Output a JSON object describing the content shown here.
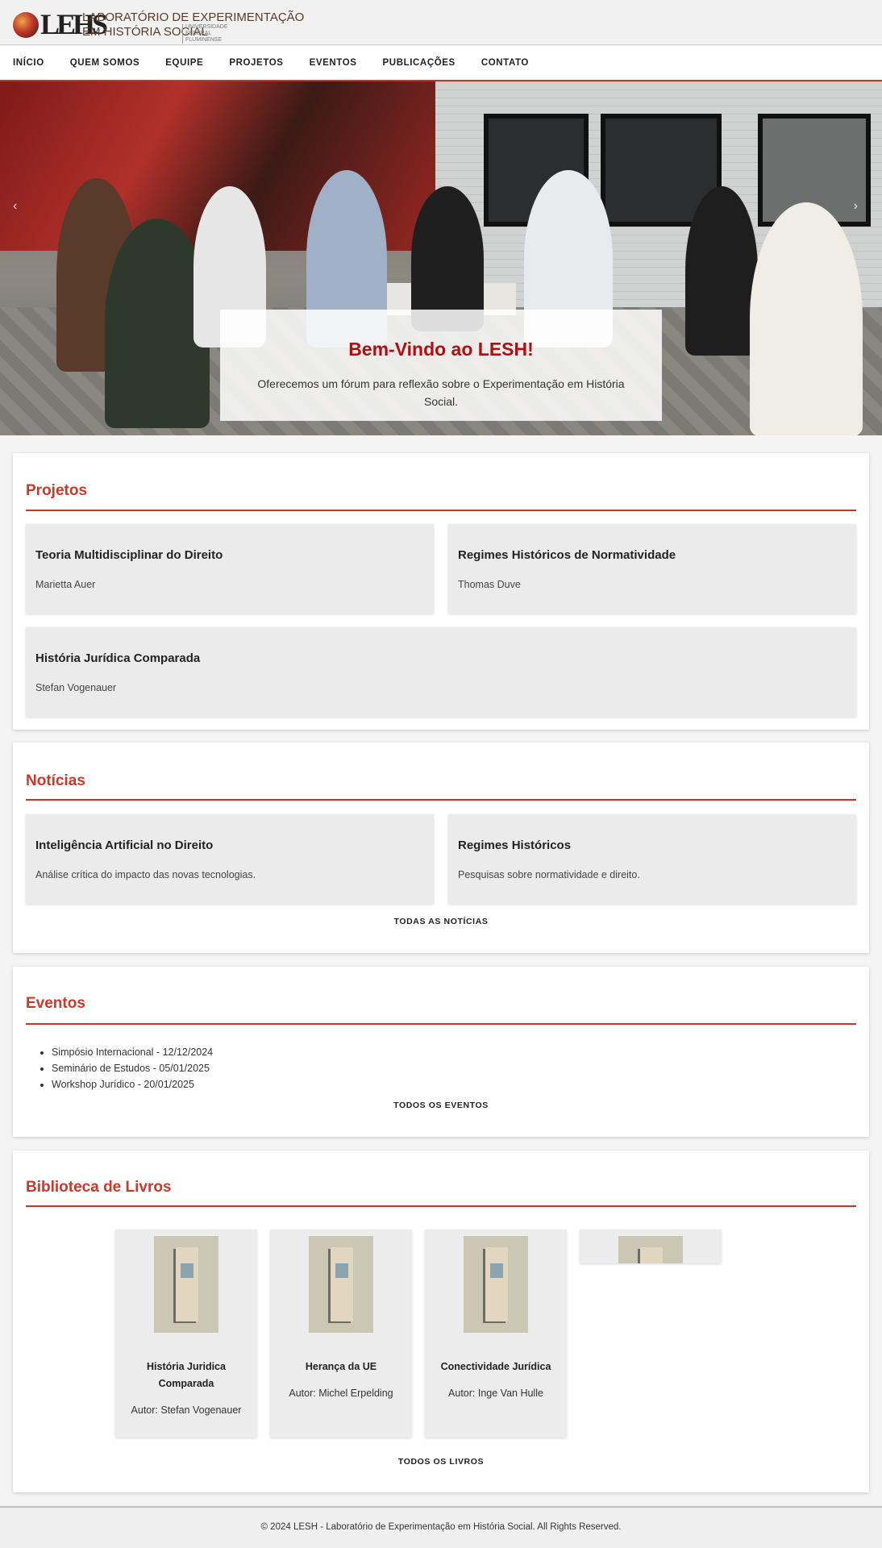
{
  "logo": {
    "monogram": "LEHS",
    "line1": "LABORATÓRIO DE EXPERIMENTAÇÃO",
    "line2": "EM HISTÓRIA SOCIAL",
    "university": "UNIVERSIDADE FEDERAL FLUMINENSE"
  },
  "nav": [
    "INÍCIO",
    "QUEM SOMOS",
    "EQUIPE",
    "PROJETOS",
    "EVENTOS",
    "PUBLICAÇÕES",
    "CONTATO"
  ],
  "hero": {
    "title": "Bem-Vindo ao LESH!",
    "text": "Oferecemos um fórum para reflexão sobre o Experimentação em História Social.",
    "prev_icon": "‹",
    "next_icon": "›"
  },
  "projects": {
    "title": "Projetos",
    "items": [
      {
        "name": "Teoria Multidisciplinar do Direito",
        "author": "Marietta Auer"
      },
      {
        "name": "Regimes Históricos de Normatividade",
        "author": "Thomas Duve"
      },
      {
        "name": "História Jurídica Comparada",
        "author": "Stefan Vogenauer"
      }
    ]
  },
  "news": {
    "title": "Notícias",
    "items": [
      {
        "title": "Inteligência Artificial no Direito",
        "text": "Análise crítica do impacto das novas tecnologias."
      },
      {
        "title": "Regimes Históricos",
        "text": "Pesquisas sobre normatividade e direito."
      }
    ],
    "all_link": "TODAS AS NOTÍCIAS"
  },
  "events": {
    "title": "Eventos",
    "items": [
      "Simpósio Internacional - 12/12/2024",
      "Seminário de Estudos - 05/01/2025",
      "Workshop Jurídico - 20/01/2025"
    ],
    "all_link": "TODOS OS EVENTOS"
  },
  "books": {
    "title": "Biblioteca de Livros",
    "items": [
      {
        "title": "História Juridica Comparada",
        "author": "Autor: Stefan Vogenauer"
      },
      {
        "title": "Herança da UE",
        "author": "Autor: Michel Erpelding"
      },
      {
        "title": "Conectividade Jurídica",
        "author": "Autor: Inge Van Hulle"
      }
    ],
    "all_link": "TODOS OS LIVROS"
  },
  "footer": "© 2024 LESH - Laboratório de Experimentação em História Social. All Rights Reserved.",
  "colors": {
    "accent": "#c0392b",
    "hero_title": "#b30d0d"
  }
}
